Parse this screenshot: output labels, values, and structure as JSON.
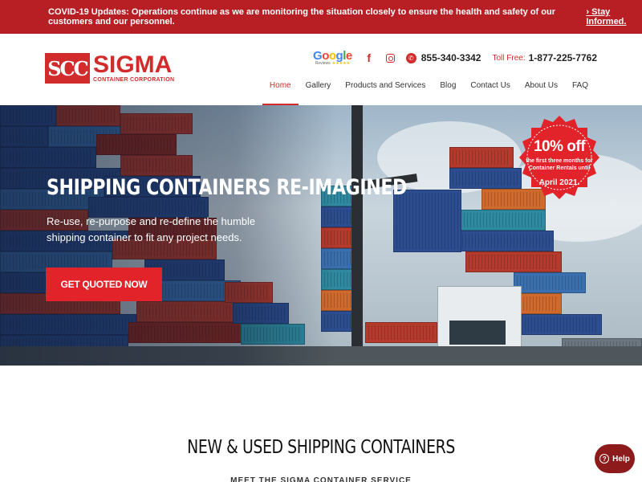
{
  "alert": {
    "text": "COVID-19 Updates: Operations continue as we are monitoring the situation closely to ensure the health and safety of our customers and our personnel.",
    "link": "› Stay Informed."
  },
  "brand": {
    "mark": "SCC",
    "name": "SIGMA",
    "subtitle": "CONTAINER CORPORATION"
  },
  "header": {
    "google_word": [
      "G",
      "o",
      "o",
      "g",
      "l",
      "e"
    ],
    "google_reviews": "Reviews",
    "google_stars": "★★★★★",
    "phone": "855-340-3342",
    "tollfree_label": "Toll Free:",
    "tollfree_number": "1-877-225-7762"
  },
  "nav": {
    "items": [
      {
        "label": "Home",
        "active": true
      },
      {
        "label": "Gallery"
      },
      {
        "label": "Products and Services"
      },
      {
        "label": "Blog"
      },
      {
        "label": "Contact Us"
      },
      {
        "label": "About Us"
      },
      {
        "label": "FAQ"
      }
    ]
  },
  "hero": {
    "title": "SHIPPING CONTAINERS RE-IMAGINED",
    "text": "Re-use, re-purpose and re-define the humble shipping container to fit any project needs.",
    "cta": "GET QUOTED NOW",
    "badge_big": "10% off",
    "badge_small": "the first three months for Container Rentals until",
    "badge_date": "April 2021."
  },
  "section": {
    "title": "NEW & USED SHIPPING CONTAINERS",
    "subtitle": "MEET THE SIGMA CONTAINER SERVICE"
  },
  "help": {
    "label": "Help",
    "icon": "?"
  },
  "colors": {
    "brand_red": "#d12b2b",
    "alert_red": "#b71f24",
    "cta_red": "#e2232a",
    "help_dark_red": "#8e1b1b"
  }
}
